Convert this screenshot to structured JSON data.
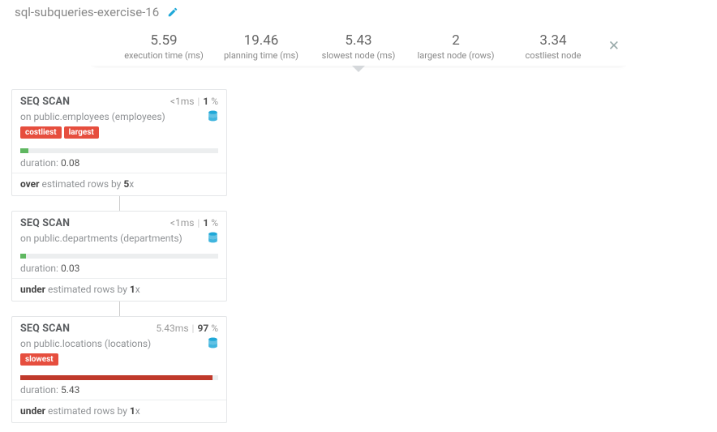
{
  "header": {
    "title": "sql-subqueries-exercise-16"
  },
  "stats": [
    {
      "value": "5.59",
      "label": "execution time (ms)"
    },
    {
      "value": "19.46",
      "label": "planning time (ms)"
    },
    {
      "value": "5.43",
      "label": "slowest node (ms)"
    },
    {
      "value": "2",
      "label": "largest node (rows)"
    },
    {
      "value": "3.34",
      "label": "costliest node"
    }
  ],
  "nodes": [
    {
      "op": "SEQ SCAN",
      "time_prefix": "<1",
      "time_unit": "ms",
      "pct": "1",
      "relation_prefix": "on ",
      "relation": "public.employees (employees)",
      "tags": [
        "costliest",
        "largest"
      ],
      "bar_class": "bar-green",
      "bar_width": "4%",
      "duration_label": "duration: ",
      "duration": "0.08",
      "est_kind": "over",
      "est_mid": " estimated rows by ",
      "est_factor": "5",
      "est_suffix": "x"
    },
    {
      "op": "SEQ SCAN",
      "time_prefix": "<1",
      "time_unit": "ms",
      "pct": "1",
      "relation_prefix": "on ",
      "relation": "public.departments (departments)",
      "tags": [],
      "bar_class": "bar-green",
      "bar_width": "3%",
      "duration_label": "duration: ",
      "duration": "0.03",
      "est_kind": "under",
      "est_mid": " estimated rows by ",
      "est_factor": "1",
      "est_suffix": "x"
    },
    {
      "op": "SEQ SCAN",
      "time_prefix": "5.43",
      "time_unit": "ms",
      "pct": "97",
      "relation_prefix": "on ",
      "relation": "public.locations (locations)",
      "tags": [
        "slowest"
      ],
      "bar_class": "bar-red",
      "bar_width": "97%",
      "duration_label": "duration: ",
      "duration": "5.43",
      "est_kind": "under",
      "est_mid": " estimated rows by ",
      "est_factor": "1",
      "est_suffix": "x"
    }
  ]
}
